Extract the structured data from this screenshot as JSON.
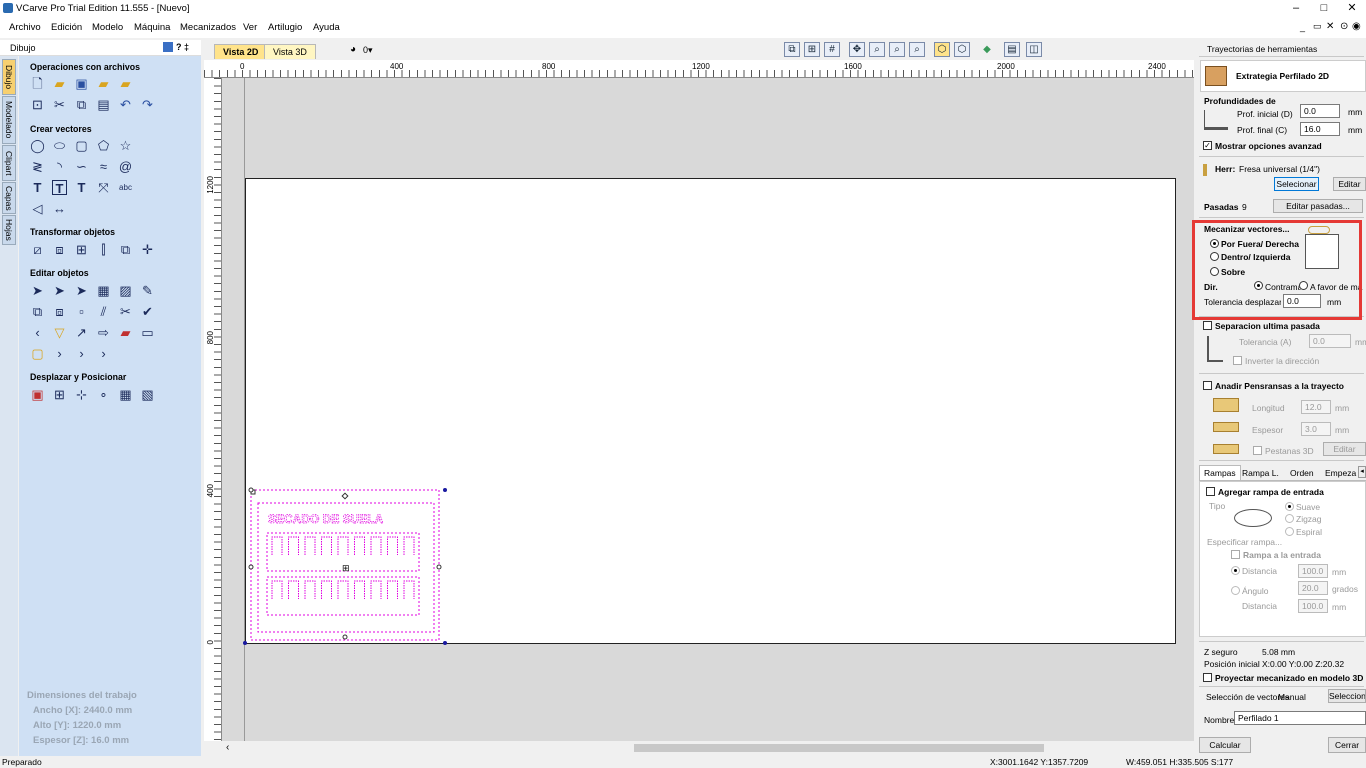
{
  "window": {
    "title": "VCarve Pro Trial Edition 11.555 - [Nuevo]"
  },
  "menu": [
    "Archivo",
    "Edición",
    "Modelo",
    "Máquina",
    "Mecanizados",
    "Ver",
    "Artilugio",
    "Ayuda"
  ],
  "left": {
    "header": "Dibujo",
    "header_controls": "? ‡",
    "sidetabs": [
      "Dibujo",
      "Modelado",
      "Clipart",
      "Capas",
      "Hojas"
    ],
    "sections": {
      "file_ops": "Operaciones con archivos",
      "create_vectors": "Crear vectores",
      "transform": "Transformar objetos",
      "edit": "Editar objetos",
      "move": "Desplazar y Posicionar"
    },
    "job_dims": {
      "title": "Dimensiones del trabajo",
      "width": "Ancho  [X]: 2440.0 mm",
      "height": "Alto    [Y]: 1220.0 mm",
      "thickness": "Espesor [Z]: 16.0 mm"
    }
  },
  "view": {
    "tab2d": "Vista 2D",
    "tab3d": "Vista 3D",
    "layer_count": "0▾",
    "ruler_x": [
      "0",
      "400",
      "800",
      "1200",
      "1600",
      "2000",
      "2400"
    ],
    "ruler_y": [
      "1200",
      "800",
      "400",
      "0"
    ],
    "preview_title": "SECADO DE SUELA"
  },
  "right": {
    "header": "Trayectorias de herramientas",
    "strategy": "Extrategia Perfilado 2D",
    "depths": {
      "title": "Profundidades de",
      "start_label": "Prof. inicial (D)",
      "start_value": "0.0",
      "end_label": "Prof. final (C)",
      "end_value": "16.0",
      "unit": "mm",
      "advanced": "Mostrar opciones avanzad"
    },
    "tool": {
      "label": "Herr:",
      "name": "Fresa universal (1/4\")",
      "select": "Selecionar",
      "edit": "Editar",
      "passes_label": "Pasadas",
      "passes_value": "9",
      "edit_passes": "Editar pasadas..."
    },
    "machine": {
      "title": "Mecanizar vectores...",
      "outside": "Por Fuera/ Derecha",
      "inside": "Dentro/ Izquierda",
      "on": "Sobre",
      "dir": "Dir.",
      "climb": "Contrama",
      "conventional": "A favor de ma",
      "offset_label": "Tolerancia desplazam",
      "offset_value": "0.0",
      "unit": "mm"
    },
    "last_pass": {
      "title": "Separacion ultima pasada",
      "tolerance": "Tolerancia (A)",
      "value": "0.0",
      "unit": "mm",
      "invert": "Inverter la dirección"
    },
    "tabs_opts": {
      "title": "Anadir Pensransas a la trayecto",
      "length": "Longitud",
      "length_val": "12.0",
      "thickness": "Espesor",
      "thick_val": "3.0",
      "unit": "mm",
      "tabs3d": "Pestanas 3D",
      "edit_tabs": "Editar Pesta"
    },
    "subtabs": [
      "Rampas",
      "Rampa L.",
      "Orden",
      "Empeza"
    ],
    "ramps": {
      "add": "Agregar rampa de entrada",
      "type": "Tipo",
      "smooth": "Suave",
      "zigzag": "Zigzag",
      "spiral": "Espiral",
      "specify": "Especificar rampa...",
      "ramp_in": "Rampa a la entrada",
      "distance": "Distancia",
      "dist_val": "100.0",
      "angle": "Ángulo",
      "angle_val": "20.0",
      "deg": "grados",
      "distance2": "Distancia",
      "dist2_val": "100.0",
      "unit": "mm"
    },
    "bottom": {
      "zsafe_label": "Z seguro",
      "zsafe": "5.08 mm",
      "home_label": "Posición inicial",
      "home": "X:0.00 Y:0.00 Z:20.32",
      "project": "Proyectar mecanizado en modelo 3D",
      "vector_sel_label": "Selección de vectores",
      "vector_sel": "Manual",
      "select_btn": "Selecciona",
      "name_label": "Nombre:",
      "name": "Perfilado 1",
      "calc": "Calcular",
      "close": "Cerrar"
    }
  },
  "status": {
    "left": "Preparado",
    "coords": "X:3001.1642 Y:1357.7209",
    "size": "W:459.051  H:335.505  S:177"
  },
  "colors": {
    "highlight": "#e53935",
    "selection": "#e000e0",
    "panel": "#cfe0f4"
  }
}
